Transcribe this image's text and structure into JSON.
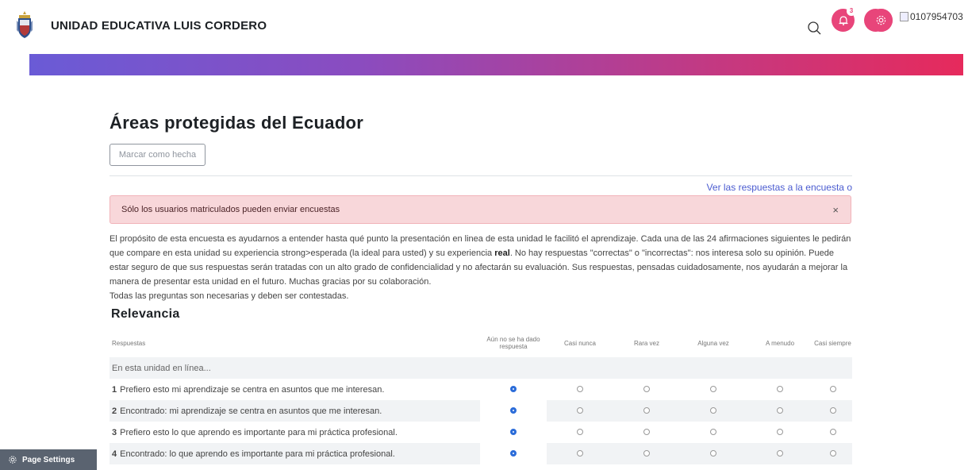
{
  "header": {
    "site_name": "UNIDAD EDUCATIVA LUIS CORDERO",
    "notification_count": "3",
    "user_image_alt": "0107954703",
    "brand_color": "#e8457a"
  },
  "page": {
    "title": "Áreas protegidas del Ecuador",
    "mark_done_label": "Marcar como hecha",
    "responses_link": "Ver las respuestas a la encuesta o",
    "alert_text": "Sólo los usuarios matriculados pueden enviar encuestas",
    "alert_close": "×",
    "intro_part1": "El propósito de esta encuesta es ayudarnos a entender hasta qué punto la presentación en linea de esta unidad le facilitó el aprendizaje. Cada una de las 24 afirmaciones siguientes le pedirán que compare en esta unidad su experiencia strong>esperada (la ideal para usted) y su experiencia ",
    "intro_bold": "real",
    "intro_part2": ". No hay respuestas \"correctas\" o \"incorrectas\": nos interesa solo su opinión. Puede estar seguro de que sus respuestas serán tratadas con un alto grado de confidencialidad y no afectarán su evaluación. Sus respuestas, pensadas cuidadosamente, nos ayudarán a mejorar la manera de presentar esta unidad en el futuro. Muchas gracias por su colaboración.",
    "intro_line2": "Todas las preguntas son necesarias y deben ser contestadas."
  },
  "survey": {
    "section_title": "Relevancia",
    "columns": [
      "Respuestas",
      "Aún no se ha dado respuesta",
      "Casi nunca",
      "Rara vez",
      "Alguna vez",
      "A menudo",
      "Casi siempre"
    ],
    "subheader": "En esta unidad en línea...",
    "rows": [
      {
        "num": "1",
        "text": "Prefiero esto   mi aprendizaje se centra en asuntos que me interesan.",
        "selected": 0
      },
      {
        "num": "2",
        "text": "Encontrado:   mi aprendizaje se centra en asuntos que me interesan.",
        "selected": 0
      },
      {
        "num": "3",
        "text": "Prefiero esto   lo que aprendo es importante para mi práctica profesional.",
        "selected": 0
      },
      {
        "num": "4",
        "text": "Encontrado:   lo que aprendo es importante para mi práctica profesional.",
        "selected": 0
      }
    ]
  },
  "footer": {
    "page_settings_label": "Page Settings"
  }
}
